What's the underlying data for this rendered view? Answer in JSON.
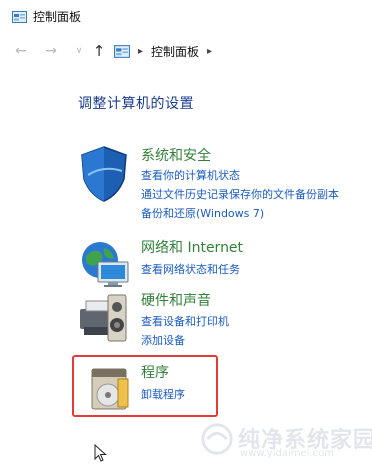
{
  "window": {
    "title": "控制面板",
    "app_icon": "control-panel-icon"
  },
  "nav": {
    "back_icon": "back-arrow-icon",
    "forward_icon": "forward-arrow-icon",
    "recent_icon": "chevron-down-icon",
    "up_icon": "up-arrow-icon",
    "breadcrumb": [
      "控制面板"
    ]
  },
  "main": {
    "heading": "调整计算机的设置",
    "categories": [
      {
        "title": "系统和安全",
        "icon": "security-shield-icon",
        "links": [
          "查看你的计算机状态",
          "通过文件历史记录保存你的文件备份副本",
          "备份和还原(Windows 7)"
        ]
      },
      {
        "title": "网络和 Internet",
        "icon": "network-globe-icon",
        "links": [
          "查看网络状态和任务"
        ]
      },
      {
        "title": "硬件和声音",
        "icon": "printer-speaker-icon",
        "links": [
          "查看设备和打印机",
          "添加设备"
        ]
      },
      {
        "title": "程序",
        "icon": "programs-disc-icon",
        "links": [
          "卸载程序"
        ]
      }
    ]
  },
  "watermark": {
    "text": "纯净系统家园",
    "url": "www.yidaimei.com"
  },
  "colors": {
    "heading": "#1a3c8c",
    "category_title": "#33803a",
    "link": "#1a5bbf",
    "highlight": "#e33a3a"
  }
}
